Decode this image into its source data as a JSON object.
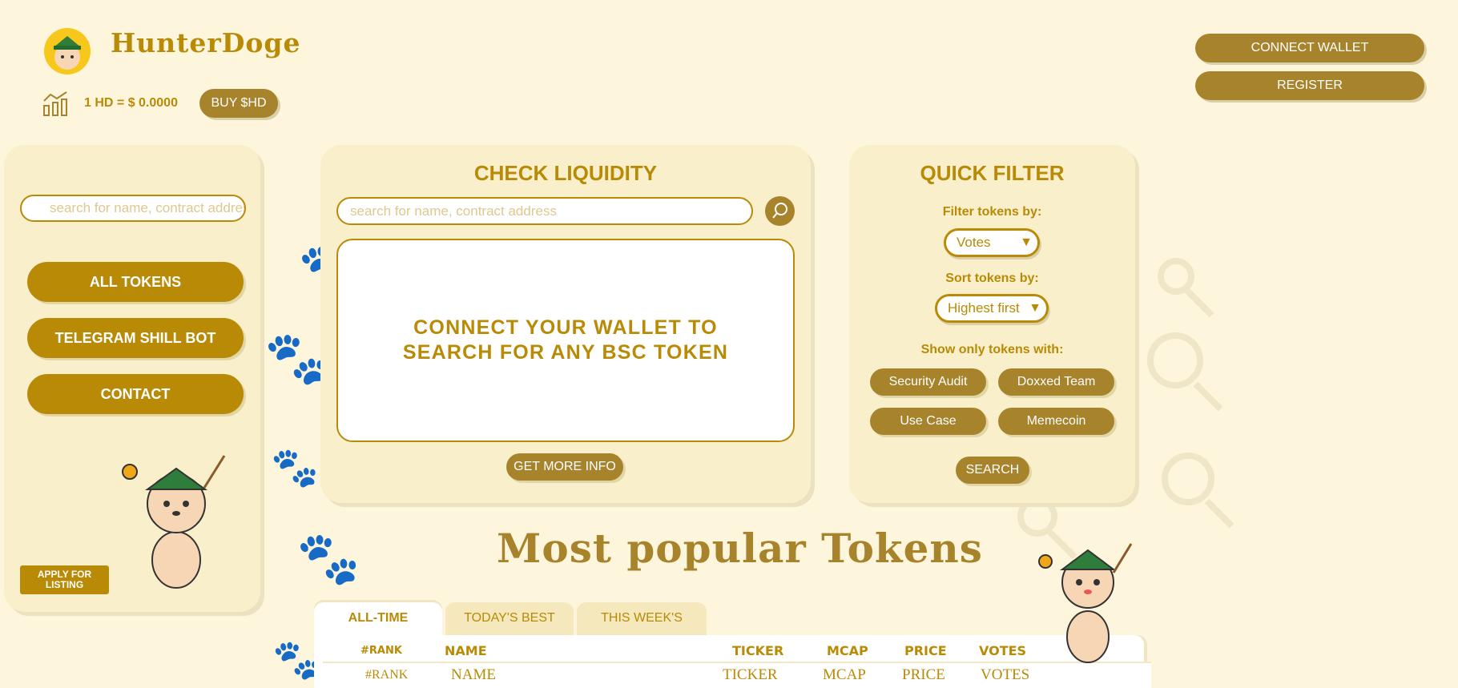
{
  "header": {
    "brand": "HunterDoge",
    "price_text": "1 HD = $ 0.0000",
    "buy_label": "BUY $HD",
    "connect_wallet_label": "CONNECT WALLET",
    "register_label": "REGISTER"
  },
  "sidebar": {
    "search_placeholder": "search for name, contract address",
    "items": [
      {
        "label": "ALL TOKENS"
      },
      {
        "label": "TELEGRAM SHILL BOT"
      },
      {
        "label": "CONTACT"
      }
    ],
    "apply_label": "APPLY FOR LISTING"
  },
  "liquidity": {
    "title": "CHECK LIQUIDITY",
    "search_placeholder": "search for name, contract address",
    "message": "CONNECT YOUR WALLET TO SEARCH FOR ANY BSC TOKEN",
    "more_info_label": "GET MORE INFO"
  },
  "quick_filter": {
    "title": "QUICK FILTER",
    "filter_label": "Filter tokens by:",
    "filter_value": "Votes",
    "sort_label": "Sort tokens by:",
    "sort_value": "Highest first",
    "show_label": "Show only tokens with:",
    "tags": [
      "Security Audit",
      "Doxxed Team",
      "Use Case",
      "Memecoin"
    ],
    "search_label": "SEARCH"
  },
  "popular": {
    "title": "Most popular Tokens",
    "tabs": [
      {
        "label": "ALL-TIME",
        "active": true
      },
      {
        "label": "TODAY'S BEST",
        "active": false
      },
      {
        "label": "THIS WEEK'S",
        "active": false
      }
    ],
    "headers": [
      "#RANK",
      "NAME",
      "TICKER",
      "MCAP",
      "PRICE",
      "VOTES"
    ],
    "row": [
      "#RANK",
      "NAME",
      "TICKER",
      "MCAP",
      "PRICE",
      "VOTES"
    ]
  },
  "icons": {
    "chart": "bar-chart-icon",
    "search": "search-icon",
    "caret": "caret-down-icon"
  },
  "colors": {
    "background": "#fdf6dc",
    "panel": "#f9efcb",
    "accent": "#b88a06",
    "button": "#a7842c"
  }
}
